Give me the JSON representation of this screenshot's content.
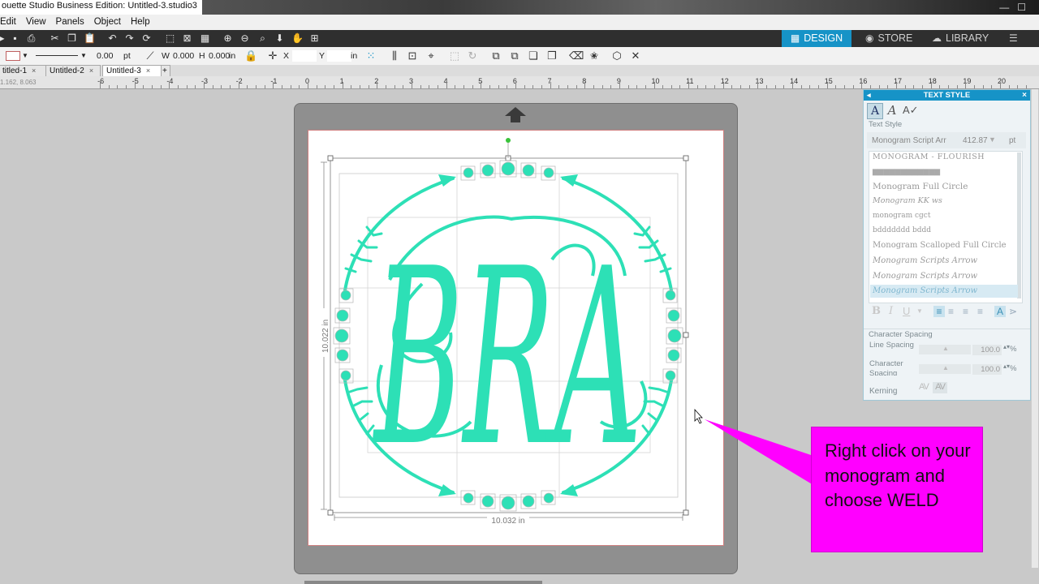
{
  "window": {
    "title": "ouette Studio Business Edition: Untitled-3.studio3"
  },
  "menu": [
    "Edit",
    "View",
    "Panels",
    "Object",
    "Help"
  ],
  "mode_tabs": {
    "design": "DESIGN",
    "store": "STORE",
    "library": "LIBRARY"
  },
  "toolbar2": {
    "line_width": "0.00",
    "line_unit": "pt",
    "w_label": "W",
    "w_value": "0.000",
    "h_label": "H",
    "h_value": "0.000",
    "size_unit": "in",
    "x_label": "X",
    "y_label": "Y",
    "pos_unit": "in"
  },
  "doc_tabs": [
    "titled-1",
    "Untitled-2",
    "Untitled-3"
  ],
  "coord_readout": "1.162, 8.063",
  "ruler_labels": [
    "-6",
    "-5",
    "-4",
    "-3",
    "-2",
    "-1",
    "0",
    "1",
    "2",
    "3",
    "4",
    "5",
    "6",
    "7",
    "8",
    "9",
    "10",
    "11",
    "12",
    "13",
    "14",
    "15",
    "16",
    "17",
    "18",
    "19",
    "20"
  ],
  "design": {
    "monogram_text": "BRA",
    "height_label": "10.022 in",
    "width_label": "10.032 in",
    "color": "#2de0b6"
  },
  "text_style_panel": {
    "title": "TEXT STYLE",
    "section": "Text Style",
    "font_name": "Monogram Script Arr",
    "font_size": "412.87",
    "font_unit": "pt",
    "fonts": [
      "MONOGRAM - FLOURISH",
      "▆▆▆▆▆▆▆▆▆▆▆▆",
      "Monogram Full Circle",
      "Monogram KK ws",
      "monogram cgct",
      "bddddddd bddd",
      "Monogram Scalloped Full Circle",
      "Monogram Scripts Arrow",
      "Monogram Scripts Arrow",
      "Monogram Scripts Arrow"
    ],
    "character_spacing_title": "Character Spacing",
    "line_spacing_label": "Line Spacing",
    "line_spacing_value": "100.0",
    "char_spacing_label": "Character Spacing",
    "char_spacing_value": "100.0",
    "percent": "%",
    "kerning_label": "Kerning"
  },
  "callout": {
    "text": "Right click on your monogram and choose WELD",
    "color": "#ff00ff"
  }
}
